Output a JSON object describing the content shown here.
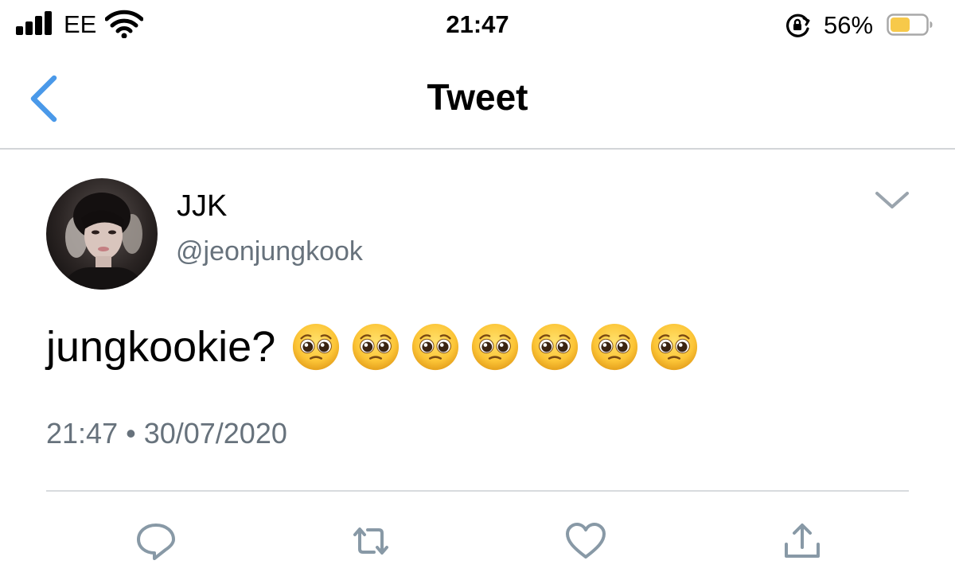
{
  "status_bar": {
    "carrier": "EE",
    "time": "21:47",
    "battery_percent": "56%",
    "battery_level": 0.56,
    "battery_color": "#f7c94a",
    "icons": [
      "signal-bars-icon",
      "wifi-icon",
      "orientation-lock-icon",
      "battery-icon"
    ]
  },
  "nav": {
    "title": "Tweet",
    "back_icon": "chevron-left-icon",
    "accent_color": "#4a99e9"
  },
  "tweet": {
    "author": {
      "display_name": "JJK",
      "handle": "@jeonjungkook",
      "avatar": "profile-photo"
    },
    "text": "jungkookie?",
    "emoji": [
      "🥺",
      "🥺",
      "🥺",
      "🥺",
      "🥺",
      "🥺",
      "🥺"
    ],
    "emoji_name": "pleading-face-icon",
    "timestamp": "21:47 • 30/07/2020",
    "more_icon": "chevron-down-icon"
  },
  "actions": [
    {
      "name": "reply-button",
      "icon": "reply-icon"
    },
    {
      "name": "retweet-button",
      "icon": "retweet-icon"
    },
    {
      "name": "like-button",
      "icon": "heart-icon"
    },
    {
      "name": "share-button",
      "icon": "share-icon"
    }
  ],
  "colors": {
    "secondary_text": "#67727c",
    "icon_gray": "#8899a6",
    "divider": "#d8dbde"
  }
}
